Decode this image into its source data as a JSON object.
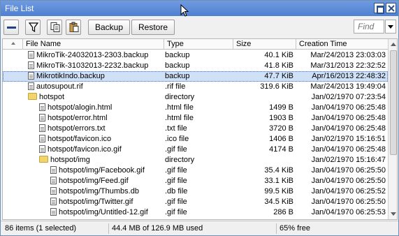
{
  "window": {
    "title": "File List"
  },
  "toolbar": {
    "backup_label": "Backup",
    "restore_label": "Restore",
    "find_placeholder": "Find"
  },
  "table": {
    "headers": {
      "name": "File Name",
      "type": "Type",
      "size": "Size",
      "date": "Creation Time"
    },
    "rows": [
      {
        "indent": 0,
        "icon": "file-icon",
        "name": "MikroTik-24032013-2303.backup",
        "type": "backup",
        "size": "40.1 KiB",
        "date": "Mar/24/2013 23:03:03",
        "selected": false
      },
      {
        "indent": 0,
        "icon": "file-icon",
        "name": "MikroTik-31032013-2232.backup",
        "type": "backup",
        "size": "41.8 KiB",
        "date": "Mar/31/2013 22:32:52",
        "selected": false
      },
      {
        "indent": 0,
        "icon": "file-icon",
        "name": "MikrotikIndo.backup",
        "type": "backup",
        "size": "47.7 KiB",
        "date": "Apr/16/2013 22:48:32",
        "selected": true
      },
      {
        "indent": 0,
        "icon": "file-icon",
        "name": "autosupout.rif",
        "type": ".rif file",
        "size": "319.6 KiB",
        "date": "Mar/24/2013 19:49:04",
        "selected": false
      },
      {
        "indent": 0,
        "icon": "folder-icon",
        "name": "hotspot",
        "type": "directory",
        "size": "",
        "date": "Jan/02/1970 07:23:54",
        "selected": false
      },
      {
        "indent": 1,
        "icon": "file-icon",
        "name": "hotspot/alogin.html",
        "type": ".html file",
        "size": "1499 B",
        "date": "Jan/04/1970 06:25:48",
        "selected": false
      },
      {
        "indent": 1,
        "icon": "file-icon",
        "name": "hotspot/error.html",
        "type": ".html file",
        "size": "1903 B",
        "date": "Jan/04/1970 06:25:48",
        "selected": false
      },
      {
        "indent": 1,
        "icon": "file-icon",
        "name": "hotspot/errors.txt",
        "type": ".txt file",
        "size": "3720 B",
        "date": "Jan/04/1970 06:25:48",
        "selected": false
      },
      {
        "indent": 1,
        "icon": "file-icon",
        "name": "hotspot/favicon.ico",
        "type": ".ico file",
        "size": "1406 B",
        "date": "Jan/02/1970 15:16:51",
        "selected": false
      },
      {
        "indent": 1,
        "icon": "file-icon",
        "name": "hotspot/favicon.ico.gif",
        "type": ".gif file",
        "size": "4174 B",
        "date": "Jan/04/1970 06:25:48",
        "selected": false
      },
      {
        "indent": 1,
        "icon": "folder-icon",
        "name": "hotspot/img",
        "type": "directory",
        "size": "",
        "date": "Jan/02/1970 15:16:47",
        "selected": false
      },
      {
        "indent": 2,
        "icon": "file-icon",
        "name": "hotspot/img/Facebook.gif",
        "type": ".gif file",
        "size": "35.4 KiB",
        "date": "Jan/04/1970 06:25:50",
        "selected": false
      },
      {
        "indent": 2,
        "icon": "file-icon",
        "name": "hotspot/img/Feed.gif",
        "type": ".gif file",
        "size": "33.1 KiB",
        "date": "Jan/04/1970 06:25:50",
        "selected": false
      },
      {
        "indent": 2,
        "icon": "file-icon",
        "name": "hotspot/img/Thumbs.db",
        "type": ".db file",
        "size": "99.5 KiB",
        "date": "Jan/04/1970 06:25:52",
        "selected": false
      },
      {
        "indent": 2,
        "icon": "file-icon",
        "name": "hotspot/img/Twitter.gif",
        "type": ".gif file",
        "size": "34.5 KiB",
        "date": "Jan/04/1970 06:25:50",
        "selected": false
      },
      {
        "indent": 2,
        "icon": "file-icon",
        "name": "hotspot/img/Untitled-12.gif",
        "type": ".gif file",
        "size": "286 B",
        "date": "Jan/04/1970 06:25:53",
        "selected": false
      }
    ]
  },
  "status": {
    "items": "86 items (1 selected)",
    "usage": "44.4 MB of 126.9 MB used",
    "free": "65% free"
  },
  "colors": {
    "titlebar": "#5a88d8",
    "selection": "#cfe0f7",
    "folder": "#f3d46b"
  }
}
